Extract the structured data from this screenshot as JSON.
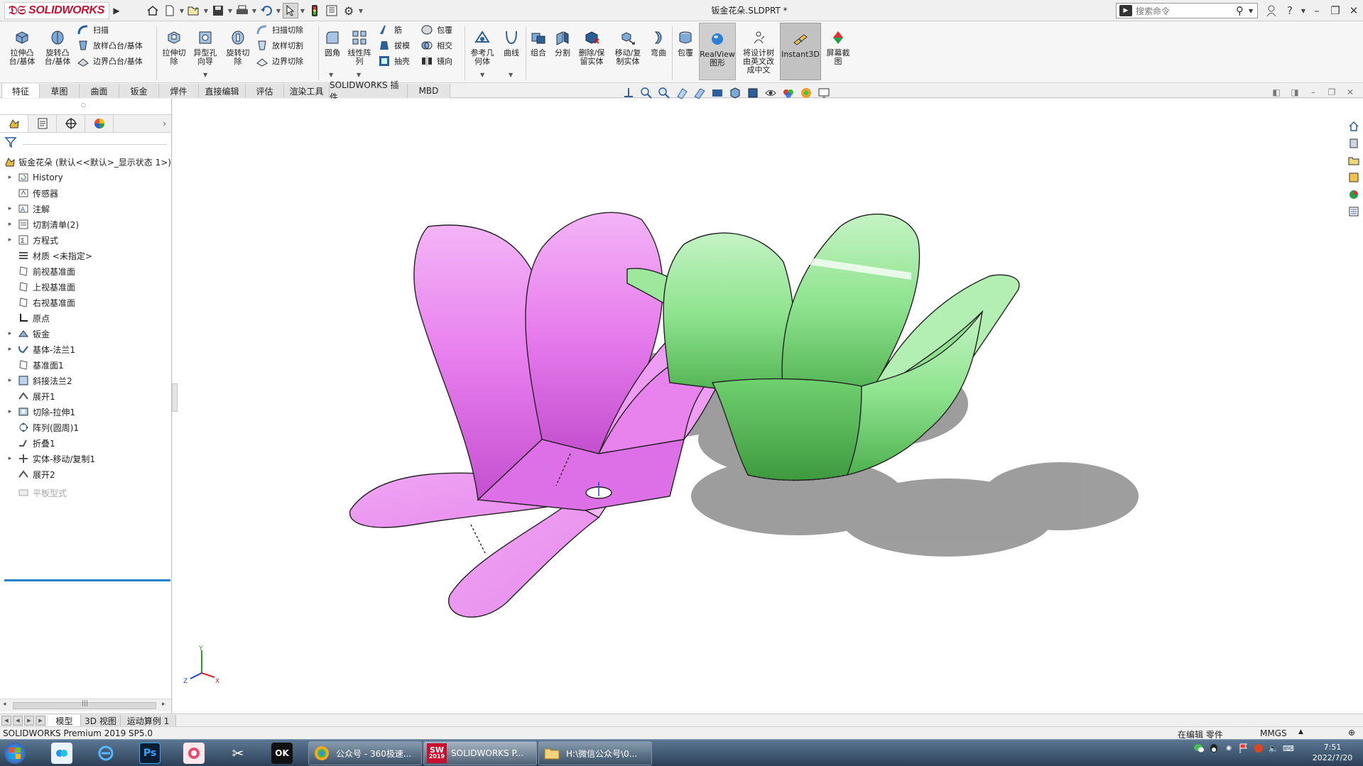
{
  "app": {
    "name": "SOLIDWORKS",
    "document_title": "钣金花朵.SLDPRT *"
  },
  "search": {
    "placeholder": "搜索命令"
  },
  "ribbon": {
    "extrude_boss": "拉伸凸\n台/基体",
    "revolve_boss": "旋转凸\n台/基体",
    "sweep": "扫描",
    "loft_boss": "放样凸台/基体",
    "boundary_boss": "边界凸台/基体",
    "extrude_cut": "拉伸切\n除",
    "hole_wizard": "异型孔\n向导",
    "revolve_cut": "旋转切\n除",
    "swept_cut": "扫描切除",
    "lofted_cut": "放样切割",
    "boundary_cut": "边界切除",
    "fillet": "圆角",
    "linear_pattern": "线性阵\n列",
    "rib": "筋",
    "draft": "拔模",
    "shell": "抽壳",
    "wrap": "包覆",
    "intersect": "相交",
    "mirror": "镜向",
    "reference_geometry": "参考几\n何体",
    "curves": "曲线",
    "combine": "组合",
    "split": "分割",
    "delete_keep_body": "删除/保\n留实体",
    "move_copy_body": "移动/复\n制实体",
    "flex": "弯曲",
    "wrap2": "包覆",
    "realview": "RealView\n图形",
    "tree_english": "将设计树\n由英文改\n成中文",
    "instant3d": "Instant3D",
    "screen_capture": "屏幕截\n图"
  },
  "command_tabs": [
    "特征",
    "草图",
    "曲面",
    "钣金",
    "焊件",
    "直接编辑",
    "评估",
    "渲染工具",
    "SOLIDWORKS 插件",
    "MBD"
  ],
  "feature_tree": {
    "root": "钣金花朵  (默认<<默认>_显示状态 1>)",
    "items": [
      {
        "label": "History"
      },
      {
        "label": "传感器"
      },
      {
        "label": "注解"
      },
      {
        "label": "切割清单(2)"
      },
      {
        "label": "方程式"
      },
      {
        "label": "材质 <未指定>"
      },
      {
        "label": "前视基准面"
      },
      {
        "label": "上视基准面"
      },
      {
        "label": "右视基准面"
      },
      {
        "label": "原点"
      },
      {
        "label": "钣金"
      },
      {
        "label": "基体-法兰1"
      },
      {
        "label": "基准面1"
      },
      {
        "label": "斜接法兰2"
      },
      {
        "label": "展开1"
      },
      {
        "label": "切除-拉伸1"
      },
      {
        "label": "阵列(圆周)1"
      },
      {
        "label": "折叠1"
      },
      {
        "label": "实体-移动/复制1"
      },
      {
        "label": "展开2"
      },
      {
        "label": "平板型式"
      }
    ]
  },
  "bottom_tabs": [
    "模型",
    "3D 视图",
    "运动算例 1"
  ],
  "status": {
    "left": "SOLIDWORKS Premium 2019 SP5.0",
    "editing": "在编辑 零件",
    "units": "MMGS"
  },
  "triad": {
    "x": "X",
    "y": "Y",
    "z": "Z"
  },
  "taskbar": {
    "windows": [
      {
        "label": "公众号 - 360极速..."
      },
      {
        "label": "SOLIDWORKS P..."
      },
      {
        "label": "H:\\微信公众号\\0..."
      }
    ],
    "ps_label": "Ps",
    "ok_label": "OK",
    "sw_year": "2019",
    "time": "7:51",
    "date": "2022/7/20"
  },
  "colors": {
    "pink_part": "#e98df0",
    "green_part": "#86df86",
    "solidworks_red": "#c8102e"
  }
}
